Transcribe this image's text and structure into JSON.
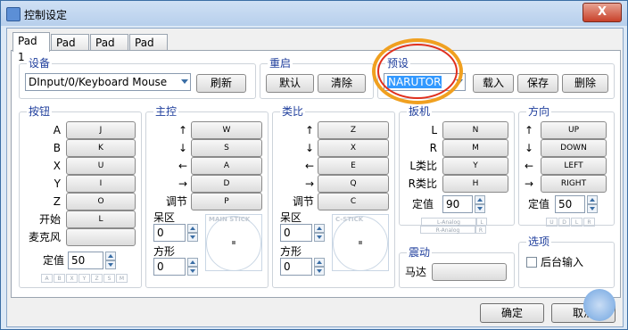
{
  "window": {
    "title": "控制设定",
    "close_label": "X"
  },
  "tabs": [
    "Pad 1",
    "Pad 2",
    "Pad 3",
    "Pad 4"
  ],
  "device": {
    "group_title": "设备",
    "selected": "DInput/0/Keyboard Mouse",
    "refresh_label": "刷新"
  },
  "reset": {
    "group_title": "重启",
    "default_label": "默认",
    "clear_label": "清除"
  },
  "preset": {
    "group_title": "预设",
    "selected": "NARUTOR",
    "load_label": "载入",
    "save_label": "保存",
    "delete_label": "删除"
  },
  "buttons_group": {
    "title": "按钮",
    "rows": [
      {
        "label": "A",
        "key": "J"
      },
      {
        "label": "B",
        "key": "K"
      },
      {
        "label": "X",
        "key": "U"
      },
      {
        "label": "Y",
        "key": "I"
      },
      {
        "label": "Z",
        "key": "O"
      },
      {
        "label": "开始",
        "key": "L"
      },
      {
        "label": "麦克风",
        "key": ""
      }
    ],
    "threshold_label": "定值",
    "threshold_value": "50",
    "mini_buttons": [
      "A",
      "B",
      "X",
      "Y",
      "Z",
      "S",
      "M"
    ]
  },
  "main_stick": {
    "title": "主控",
    "rows": [
      {
        "label": "↑",
        "key": "W"
      },
      {
        "label": "↓",
        "key": "S"
      },
      {
        "label": "←",
        "key": "A"
      },
      {
        "label": "→",
        "key": "D"
      },
      {
        "label": "调节",
        "key": "P"
      }
    ],
    "deadzone_label": "呆区",
    "deadzone_value": "0",
    "square_label": "方形",
    "square_value": "0",
    "stick_label": "MAIN STICK"
  },
  "c_stick": {
    "title": "类比",
    "rows": [
      {
        "label": "↑",
        "key": "Z"
      },
      {
        "label": "↓",
        "key": "X"
      },
      {
        "label": "←",
        "key": "E"
      },
      {
        "label": "→",
        "key": "Q"
      },
      {
        "label": "调节",
        "key": "C"
      }
    ],
    "deadzone_label": "呆区",
    "deadzone_value": "0",
    "square_label": "方形",
    "square_value": "0",
    "stick_label": "C-STICK"
  },
  "triggers": {
    "title": "扳机",
    "rows": [
      {
        "label": "L",
        "key": "N"
      },
      {
        "label": "R",
        "key": "M"
      },
      {
        "label": "L类比",
        "key": "Y"
      },
      {
        "label": "R类比",
        "key": "H"
      }
    ],
    "threshold_label": "定值",
    "threshold_value": "90",
    "analog_l": "L-Analog",
    "analog_l_tag": "L",
    "analog_r": "R-Analog",
    "analog_r_tag": "R"
  },
  "rumble": {
    "title": "震动",
    "motor_label": "马达",
    "motor_key": ""
  },
  "dpad": {
    "title": "方向",
    "rows": [
      {
        "label": "↑",
        "key": "UP"
      },
      {
        "label": "↓",
        "key": "DOWN"
      },
      {
        "label": "←",
        "key": "LEFT"
      },
      {
        "label": "→",
        "key": "RIGHT"
      }
    ],
    "threshold_label": "定值",
    "threshold_value": "50",
    "mini_buttons": [
      "U",
      "D",
      "L",
      "R"
    ]
  },
  "options": {
    "title": "选项",
    "background_input_label": "后台输入",
    "background_input_checked": false
  },
  "footer": {
    "ok_label": "确定",
    "cancel_label": "取消"
  },
  "colors": {
    "group_title": "#1f3e9c",
    "highlight": "#3399ff"
  }
}
